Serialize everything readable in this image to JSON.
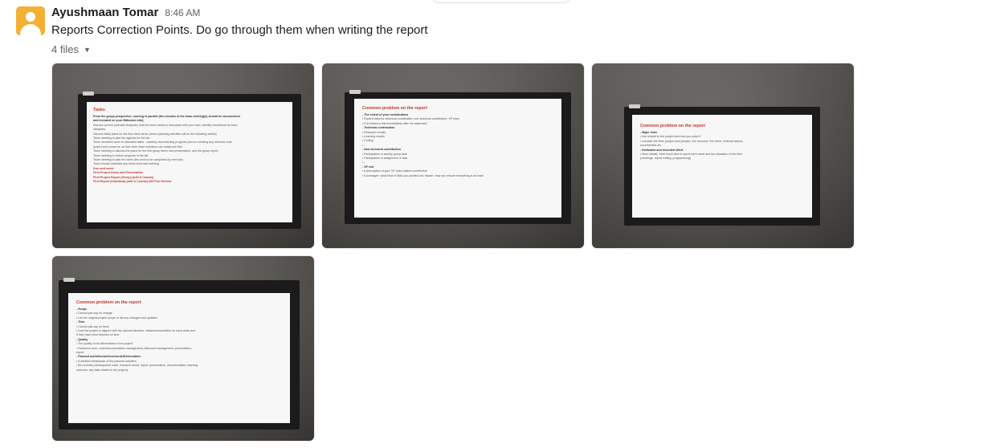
{
  "message": {
    "sender": "Ayushmaan Tomar",
    "time": "8:46 AM",
    "text": "Reports Correction Points. Do go through them when writing the report",
    "files_label": "4 files"
  },
  "icons": {
    "files_toggle": "chevron-down-icon",
    "avatar": "user-avatar-icon"
  },
  "colors": {
    "avatar_bg": "#f2b035",
    "slide_title": "#c0392b"
  },
  "slides": [
    {
      "title": "Tasks",
      "lines": [
        {
          "t": "From the group perspective, running in parallel (the minutes of the team meeting(s) should be documented",
          "s": "bold"
        },
        {
          "t": "and included on your Bitbucket site):",
          "s": "bold"
        },
        {
          "t": "Discuss current potential obstacles, that the team needs to discussed with your tutor, Identify resolutions for each",
          "s": ""
        },
        {
          "t": "obstacles",
          "s": ""
        },
        {
          "t": "Discuss initial plans for the first client demo (minor planning activities will be the following weeks)",
          "s": ""
        },
        {
          "t": "Team meeting to plan the agenda for the lab",
          "s": ""
        },
        {
          "t": "Team members work on allocated tasks - carefully documenting progress (and no creating any relevant code",
          "s": ""
        },
        {
          "t": "project and concerns, so that other team members can easily see this",
          "s": ""
        },
        {
          "t": "Team meeting to discuss the plans for the first group demo and presentation, and the group report",
          "s": ""
        },
        {
          "t": "Team meeting to review progress in the lab",
          "s": ""
        },
        {
          "t": "Team meeting to plan the week (the work to be completed by next lab)",
          "s": ""
        },
        {
          "t": "Team should celebrate any items done last meeting",
          "s": ""
        },
        {
          "t": "Due next week:",
          "s": "red"
        },
        {
          "t": "First Project Demo and Presentation",
          "s": "red"
        },
        {
          "t": "First Project Report (Group) (wiki & Canvas)",
          "s": "red"
        },
        {
          "t": "First Report (Individual) (wiki & Canvas) 360 Peer Review",
          "s": "red"
        }
      ]
    },
    {
      "title": "Common problem on the report",
      "lines": [
        {
          "t": "- The extent of your contributions",
          "s": "bold"
        },
        {
          "t": "• Explicit roles for technical contribution, non-technical contribution, XP roles",
          "s": ""
        },
        {
          "t": "• Put evidence link immediately after the statement",
          "s": ""
        },
        {
          "t": "- Technical contribution",
          "s": "bold"
        },
        {
          "t": "• Research results",
          "s": ""
        },
        {
          "t": "• Learning results",
          "s": ""
        },
        {
          "t": "• Coding",
          "s": ""
        },
        {
          "t": "• ...",
          "s": ""
        },
        {
          "t": "- Non-technical contribution",
          "s": "bold"
        },
        {
          "t": "• Participation in weekly group task",
          "s": ""
        },
        {
          "t": "• Participation in assignment & task",
          "s": ""
        },
        {
          "t": "• ...",
          "s": ""
        },
        {
          "t": "- XP role",
          "s": "bold"
        },
        {
          "t": "• A description of your XP-roles related contribution",
          "s": ""
        },
        {
          "t": "• Doomsayer: what kind of risks you pointed out; tracker: how you ensure everything is on track",
          "s": ""
        }
      ]
    },
    {
      "title": "Common problem on the report",
      "lines": [
        {
          "t": "- Major risks",
          "s": "bold"
        },
        {
          "t": "• risk related to the project and how you solve it",
          "s": ""
        },
        {
          "t": "• consider the time (project and people), the resource, the client, external factors,",
          "s": ""
        },
        {
          "t": "uncertainties etc",
          "s": ""
        },
        {
          "t": "- Estimated and recorded effort",
          "s": "bold"
        },
        {
          "t": "• More details. How much time is spent each week and the allocation of the time",
          "s": ""
        },
        {
          "t": "(meetings, report writing, programming)",
          "s": ""
        }
      ]
    },
    {
      "title": "Common problem on the report",
      "lines": [
        {
          "t": "- Scope",
          "s": "bold"
        },
        {
          "t": "• Cannot just say no change",
          "s": ""
        },
        {
          "t": "• List the original project scope or list any changes and updates",
          "s": ""
        },
        {
          "t": "- Time",
          "s": "bold"
        },
        {
          "t": "• Cannot just say on track",
          "s": ""
        },
        {
          "t": "• How the project is aligned with the planned timeline, milestones/activities for each week and",
          "s": ""
        },
        {
          "t": "if they have been finished on time",
          "s": ""
        },
        {
          "t": "- Quality",
          "s": "bold"
        },
        {
          "t": "• The quality of all deliverables in the project",
          "s": ""
        },
        {
          "t": "• Research work, code/documentation management, bitbucket management, presentation,",
          "s": ""
        },
        {
          "t": "report",
          "s": ""
        },
        {
          "t": "- Planned activities/Achievements/Deliverables",
          "s": "bold"
        },
        {
          "t": "• A detailed breakdown of the planned activities",
          "s": ""
        },
        {
          "t": "• All commits (development code, research result, report, presentation, documentation, learning",
          "s": ""
        },
        {
          "t": "outcome, any task related to the project)",
          "s": ""
        }
      ]
    }
  ]
}
